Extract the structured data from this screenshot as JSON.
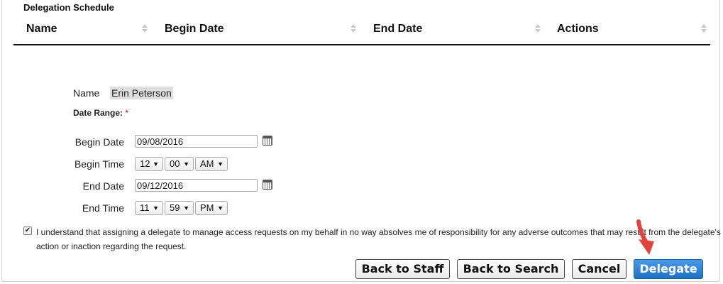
{
  "section_title": "Delegation Schedule",
  "table": {
    "columns": [
      "Name",
      "Begin Date",
      "End Date",
      "Actions"
    ]
  },
  "form": {
    "name_label": "Name",
    "name_value": "Erin Peterson",
    "date_range_label": "Date Range:",
    "required_mark": "*",
    "begin_date_label": "Begin Date",
    "begin_date_value": "09/08/2016",
    "begin_time_label": "Begin Time",
    "begin_hour": "12",
    "begin_minute": "00",
    "begin_ampm": "AM",
    "end_date_label": "End Date",
    "end_date_value": "09/12/2016",
    "end_time_label": "End Time",
    "end_hour": "11",
    "end_minute": "59",
    "end_ampm": "PM"
  },
  "agreement": {
    "checked": true,
    "text": "I understand that assigning a delegate to manage access requests on my behalf in no way absolves me of responsibility for any adverse outcomes that may result from the delegate's action or inaction regarding the request."
  },
  "buttons": {
    "back_to_staff": "Back to Staff",
    "back_to_search": "Back to Search",
    "cancel": "Cancel",
    "delegate": "Delegate"
  },
  "colors": {
    "primary_button": "#1f72c6",
    "annotation_arrow": "#e2433c",
    "required": "#c00000"
  },
  "icons": {
    "calendar": "calendar-icon",
    "sort": "sort-arrows-icon",
    "dropdown": "chevron-down-icon",
    "annotation": "red-pointer-arrow"
  }
}
